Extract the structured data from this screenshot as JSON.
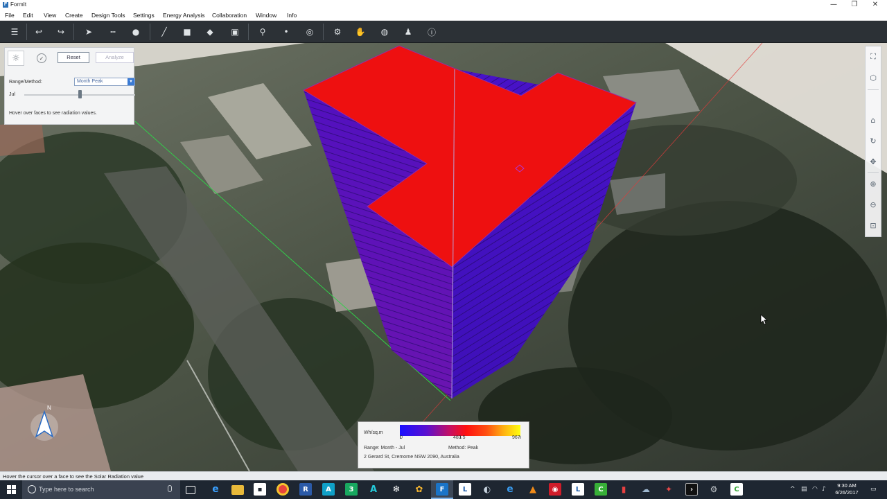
{
  "window": {
    "title": "FormIt",
    "app_letter": "F",
    "minimize": "—",
    "restore": "❐",
    "close": "✕"
  },
  "menu": [
    "File",
    "Edit",
    "View",
    "Create",
    "Design Tools",
    "Settings",
    "Energy Analysis",
    "Collaboration",
    "Window",
    "Info"
  ],
  "toolbar_icons": [
    "layers-icon",
    "undo-icon",
    "redo-icon",
    "select-icon",
    "line-icon",
    "circle-icon",
    "pen-icon",
    "cube-icon",
    "push-pull-icon",
    "group-icon",
    "location-icon",
    "point-icon",
    "orbit-icon",
    "gear-icon",
    "hand-icon",
    "globe-icon",
    "person-icon",
    "info-icon"
  ],
  "solar_panel": {
    "reset_label": "Reset",
    "analyze_label": "Analyze",
    "range_method_label": "Range/Method:",
    "range_method_value": "Month Peak",
    "month_label": "Jul",
    "month_slider_value": 0.5,
    "hint": "Hover over faces to see radiation values."
  },
  "nav_icons": [
    "fit-view-icon",
    "view-cube-icon",
    "home-view-icon",
    "orbit-icon",
    "look-icon",
    "pan-icon",
    "zoom-in-icon",
    "zoom-out-icon",
    "zoom-fit-icon"
  ],
  "legend": {
    "units": "Wh/sq.m",
    "min": "0",
    "mid": "483.5",
    "max": "967",
    "range": "Range: Month - Jul",
    "method": "Method: Peak",
    "address": "2 Gerard St, Cremorne NSW 2090, Australia"
  },
  "compass": {
    "label": "N"
  },
  "status": "Hover the cursor over a face to see the Solar Radiation value",
  "taskbar": {
    "search_placeholder": "Type here to search",
    "time": "9:30 AM",
    "date": "6/26/2017",
    "apps": [
      "task-view",
      "edge",
      "file-explorer",
      "store",
      "chrome",
      "revit",
      "autocad",
      "3",
      "acad-alt",
      "snowflake",
      "flower",
      "formit",
      "l-app",
      "steam",
      "ie",
      "vlc",
      "red-app",
      "l-app-2",
      "c-app",
      "cloud",
      "puzzle",
      "terminal",
      "folder-app",
      "c-app-2"
    ]
  },
  "colors": {
    "roof": "#ee1010",
    "facade": "#4a10b4",
    "accent": "#3b7bd4"
  }
}
